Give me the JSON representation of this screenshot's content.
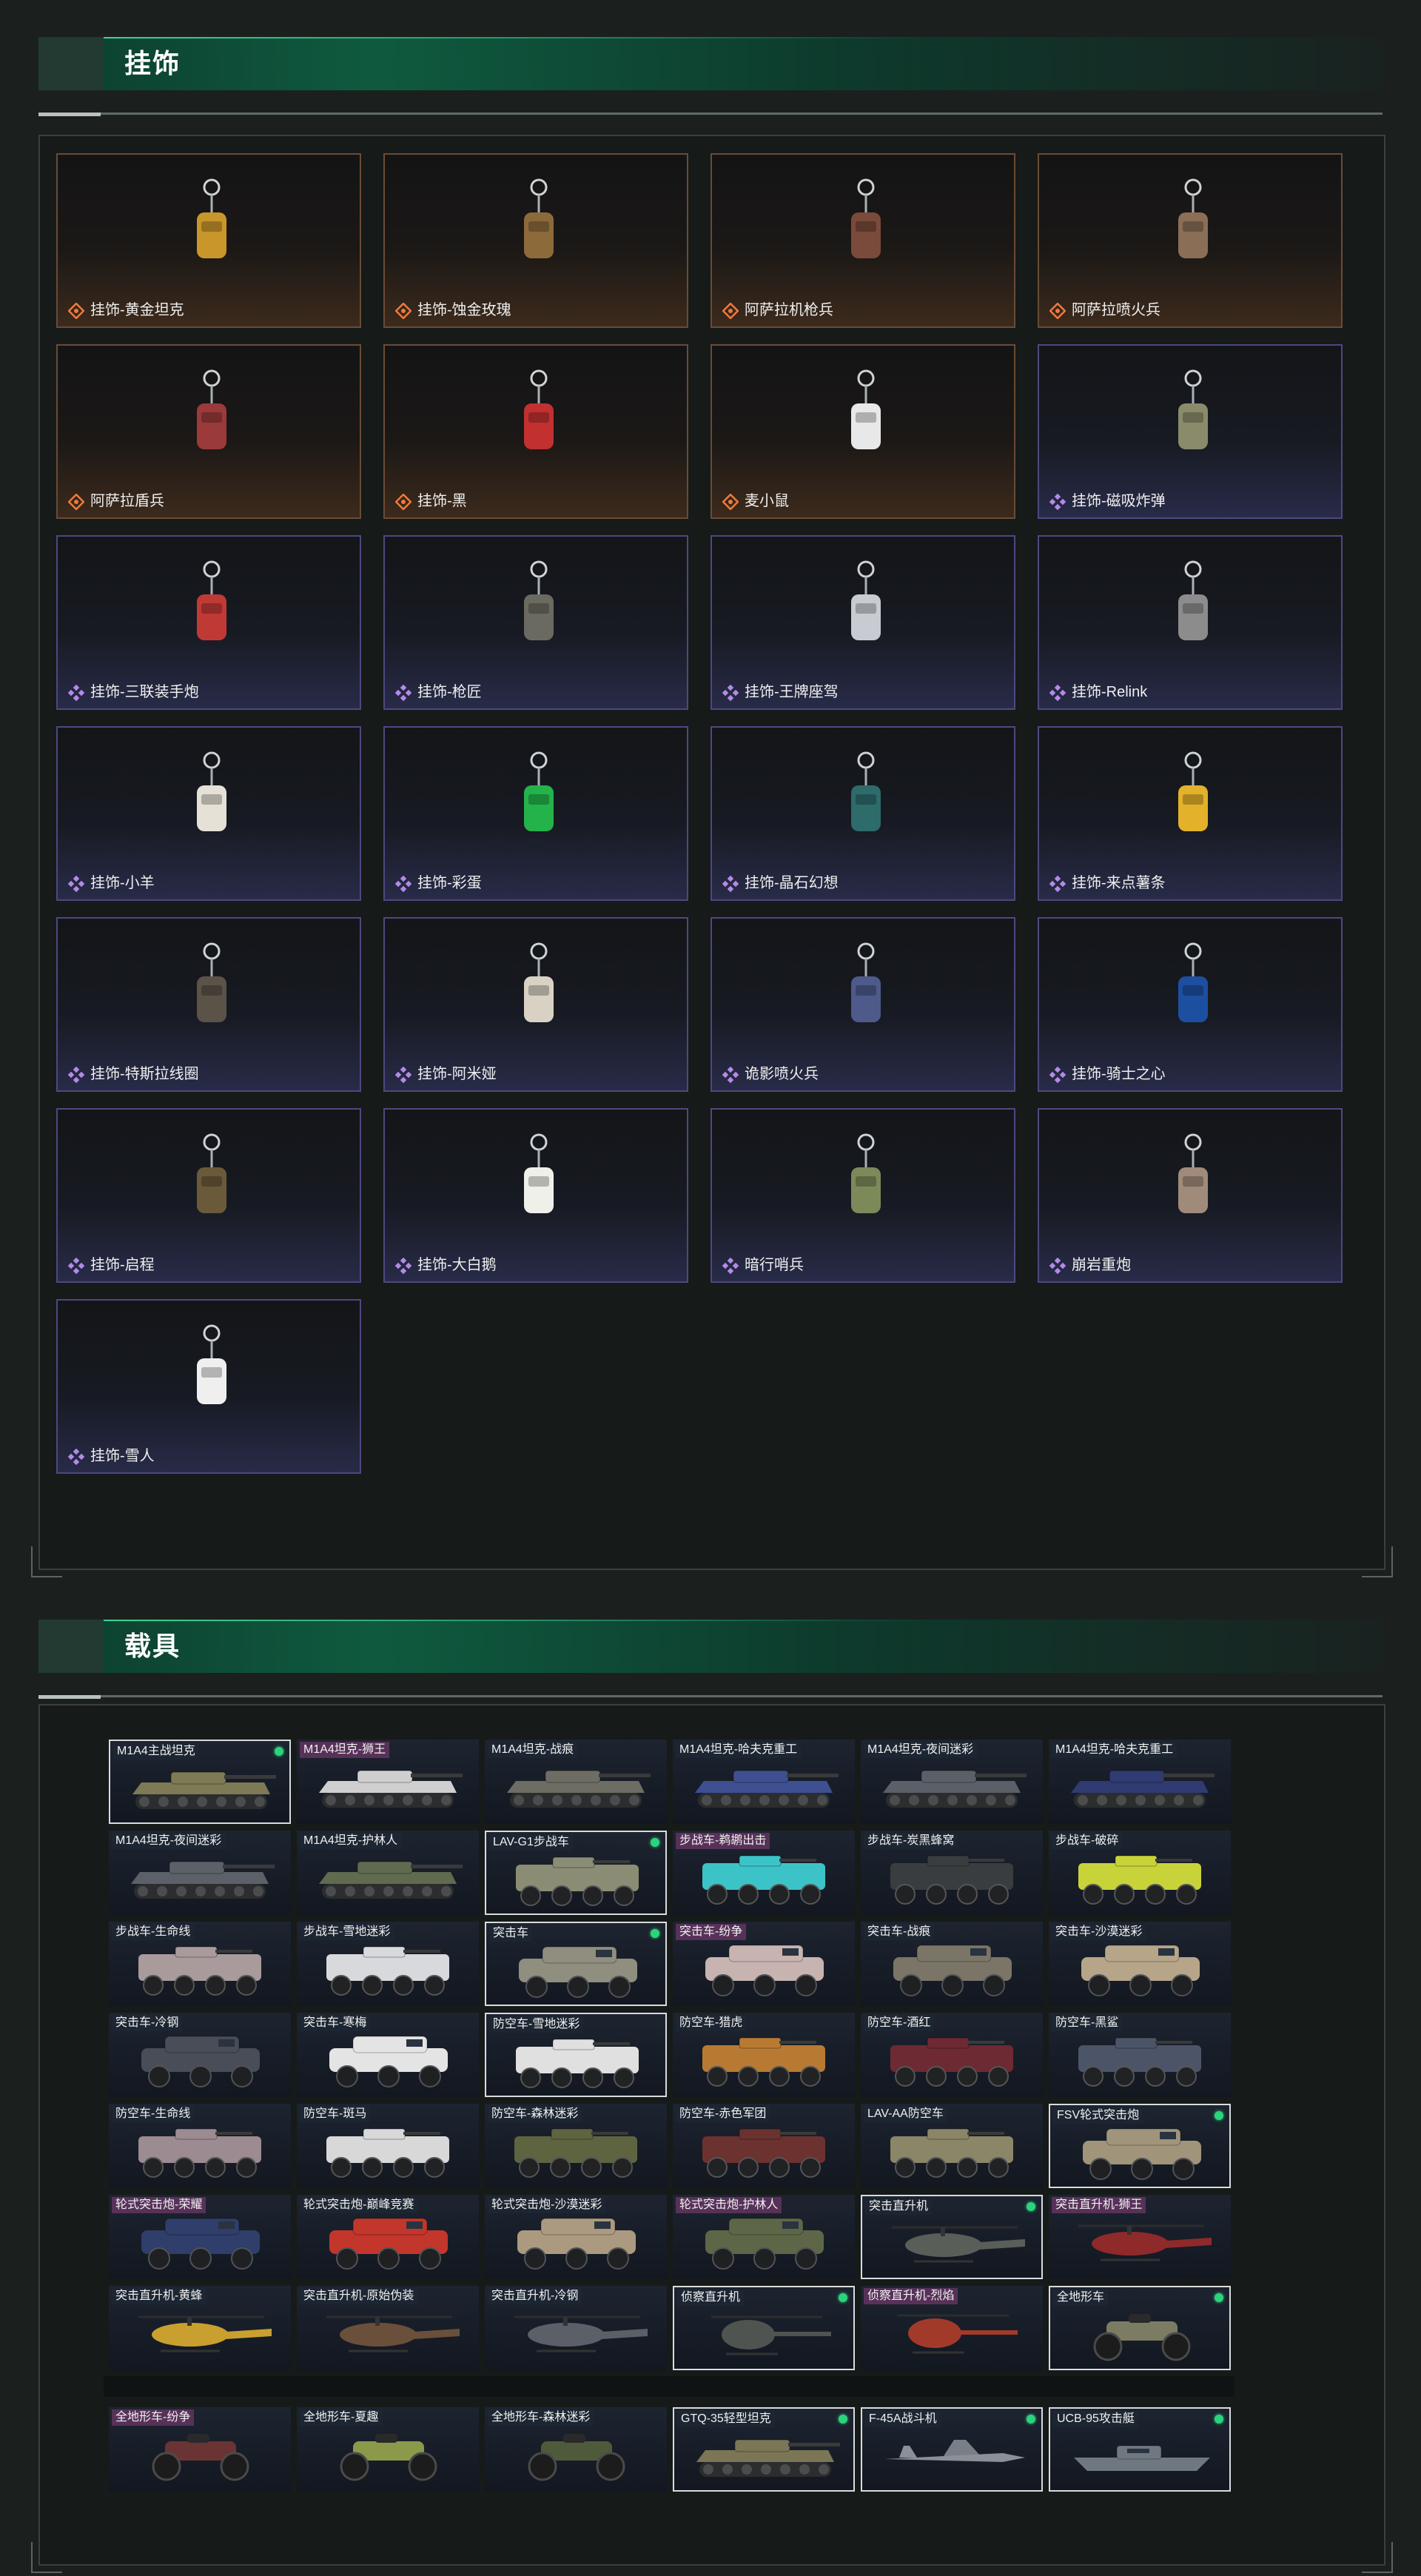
{
  "pendants_section": {
    "title": "挂饰",
    "items": [
      {
        "label": "挂饰-黄金坦克",
        "rarity": "legendary",
        "icon": "golden-tank-pendant-icon"
      },
      {
        "label": "挂饰-蚀金玫瑰",
        "rarity": "legendary",
        "icon": "rose-emblem-pendant-icon"
      },
      {
        "label": "阿萨拉机枪兵",
        "rarity": "legendary",
        "icon": "machine-gunner-figure-icon"
      },
      {
        "label": "阿萨拉喷火兵",
        "rarity": "legendary",
        "icon": "flamethrower-figure-icon"
      },
      {
        "label": "阿萨拉盾兵",
        "rarity": "legendary",
        "icon": "shield-soldier-figure-icon"
      },
      {
        "label": "挂饰-黑",
        "rarity": "legendary",
        "icon": "black-blade-pendant-icon"
      },
      {
        "label": "麦小鼠",
        "rarity": "legendary",
        "icon": "mouse-figure-icon"
      },
      {
        "label": "挂饰-磁吸炸弹",
        "rarity": "epic",
        "icon": "magnetic-bomb-pendant-icon"
      },
      {
        "label": "挂饰-三联装手炮",
        "rarity": "epic",
        "icon": "triple-hand-cannon-pendant-icon"
      },
      {
        "label": "挂饰-枪匠",
        "rarity": "epic",
        "icon": "gunsmith-box-pendant-icon"
      },
      {
        "label": "挂饰-王牌座驾",
        "rarity": "epic",
        "icon": "jet-plane-pendant-icon"
      },
      {
        "label": "挂饰-Relink",
        "rarity": "epic",
        "icon": "relink-emblem-pendant-icon"
      },
      {
        "label": "挂饰-小羊",
        "rarity": "epic",
        "icon": "lamb-pendant-icon"
      },
      {
        "label": "挂饰-彩蛋",
        "rarity": "epic",
        "icon": "green-egg-pendant-icon"
      },
      {
        "label": "挂饰-晶石幻想",
        "rarity": "epic",
        "icon": "crystal-cube-pendant-icon"
      },
      {
        "label": "挂饰-来点薯条",
        "rarity": "epic",
        "icon": "fries-pendant-icon"
      },
      {
        "label": "挂饰-特斯拉线圈",
        "rarity": "epic",
        "icon": "tesla-coil-pendant-icon"
      },
      {
        "label": "挂饰-阿米娅",
        "rarity": "epic",
        "icon": "bunny-pendant-icon"
      },
      {
        "label": "诡影喷火兵",
        "rarity": "epic",
        "icon": "shadow-flamethrower-figure-icon"
      },
      {
        "label": "挂饰-骑士之心",
        "rarity": "epic",
        "icon": "knight-heart-pendant-icon"
      },
      {
        "label": "挂饰-启程",
        "rarity": "epic",
        "icon": "departure-emblem-pendant-icon"
      },
      {
        "label": "挂饰-大白鹅",
        "rarity": "epic",
        "icon": "white-goose-pendant-icon"
      },
      {
        "label": "暗行哨兵",
        "rarity": "epic",
        "icon": "dark-sentinel-figure-icon"
      },
      {
        "label": "崩岩重炮",
        "rarity": "epic",
        "icon": "rock-cannon-figure-icon"
      },
      {
        "label": "挂饰-雪人",
        "rarity": "epic",
        "icon": "snowman-pendant-icon"
      }
    ]
  },
  "vehicles_section": {
    "title": "载具",
    "rows": [
      [
        {
          "label": "M1A4主战坦克",
          "sel": true,
          "dot": true,
          "tag": "plain",
          "kind": "tank",
          "color": "#7d7a55"
        },
        {
          "label": "M1A4坦克-狮王",
          "sel": false,
          "dot": false,
          "tag": "pink",
          "kind": "tank",
          "color": "#cfcfcf"
        },
        {
          "label": "M1A4坦克-战痕",
          "sel": false,
          "dot": false,
          "tag": "plain",
          "kind": "tank",
          "color": "#6d6d63"
        },
        {
          "label": "M1A4坦克-哈夫克重工",
          "sel": false,
          "dot": false,
          "tag": "plain",
          "kind": "tank",
          "color": "#3e4f92"
        },
        {
          "label": "M1A4坦克-夜间迷彩",
          "sel": false,
          "dot": false,
          "tag": "plain",
          "kind": "tank",
          "color": "#5b6068"
        },
        {
          "label": "M1A4坦克-哈夫克重工",
          "sel": false,
          "dot": false,
          "tag": "plain",
          "kind": "tank",
          "color": "#2f3b72"
        }
      ],
      [
        {
          "label": "M1A4坦克-夜间迷彩",
          "sel": false,
          "dot": false,
          "tag": "plain",
          "kind": "tank",
          "color": "#5c6169"
        },
        {
          "label": "M1A4坦克-护林人",
          "sel": false,
          "dot": false,
          "tag": "plain",
          "kind": "tank",
          "color": "#5f6a4f"
        },
        {
          "label": "LAV-G1步战车",
          "sel": true,
          "dot": true,
          "tag": "plain",
          "kind": "ifv",
          "color": "#8a8c74"
        },
        {
          "label": "步战车-鹈鹕出击",
          "sel": false,
          "dot": false,
          "tag": "pink",
          "kind": "ifv",
          "color": "#3cc3c7"
        },
        {
          "label": "步战车-炭黑蜂窝",
          "sel": false,
          "dot": false,
          "tag": "plain",
          "kind": "ifv",
          "color": "#3a3d40"
        },
        {
          "label": "步战车-破碎",
          "sel": false,
          "dot": false,
          "tag": "plain",
          "kind": "ifv",
          "color": "#c8d33a"
        }
      ],
      [
        {
          "label": "步战车-生命线",
          "sel": false,
          "dot": false,
          "tag": "plain",
          "kind": "ifv",
          "color": "#a99a9c"
        },
        {
          "label": "步战车-雪地迷彩",
          "sel": false,
          "dot": false,
          "tag": "plain",
          "kind": "ifv",
          "color": "#d7d9dc"
        },
        {
          "label": "突击车",
          "sel": true,
          "dot": true,
          "tag": "plain",
          "kind": "mrap",
          "color": "#8f8e7f"
        },
        {
          "label": "突击车-纷争",
          "sel": false,
          "dot": false,
          "tag": "pink",
          "kind": "mrap",
          "color": "#c7b4b0"
        },
        {
          "label": "突击车-战痕",
          "sel": false,
          "dot": false,
          "tag": "plain",
          "kind": "mrap",
          "color": "#7b7568"
        },
        {
          "label": "突击车-沙漠迷彩",
          "sel": false,
          "dot": false,
          "tag": "plain",
          "kind": "mrap",
          "color": "#b6a589"
        }
      ],
      [
        {
          "label": "突击车-冷钢",
          "sel": false,
          "dot": false,
          "tag": "plain",
          "kind": "mrap",
          "color": "#484d57"
        },
        {
          "label": "突击车-寒梅",
          "sel": false,
          "dot": false,
          "tag": "plain",
          "kind": "mrap",
          "color": "#e4e4e4"
        },
        {
          "label": "防空车-雪地迷彩",
          "sel": true,
          "dot": false,
          "tag": "plain",
          "kind": "ifv",
          "color": "#e0e0e0"
        },
        {
          "label": "防空车-猎虎",
          "sel": false,
          "dot": false,
          "tag": "plain",
          "kind": "ifv",
          "color": "#b87a33"
        },
        {
          "label": "防空车-酒红",
          "sel": false,
          "dot": false,
          "tag": "plain",
          "kind": "ifv",
          "color": "#6d2a33"
        },
        {
          "label": "防空车-黑鲨",
          "sel": false,
          "dot": false,
          "tag": "plain",
          "kind": "ifv",
          "color": "#4c5568"
        }
      ],
      [
        {
          "label": "防空车-生命线",
          "sel": false,
          "dot": false,
          "tag": "plain",
          "kind": "ifv",
          "color": "#9c8b90"
        },
        {
          "label": "防空车-斑马",
          "sel": false,
          "dot": false,
          "tag": "plain",
          "kind": "ifv",
          "color": "#d8d8d8"
        },
        {
          "label": "防空车-森林迷彩",
          "sel": false,
          "dot": false,
          "tag": "plain",
          "kind": "ifv",
          "color": "#5e6440"
        },
        {
          "label": "防空车-赤色军团",
          "sel": false,
          "dot": false,
          "tag": "plain",
          "kind": "ifv",
          "color": "#6b3230"
        },
        {
          "label": "LAV-AA防空车",
          "sel": false,
          "dot": false,
          "tag": "plain",
          "kind": "ifv",
          "color": "#8b8667"
        },
        {
          "label": "FSV轮式突击炮",
          "sel": true,
          "dot": true,
          "tag": "plain",
          "kind": "mrap",
          "color": "#a0957b"
        }
      ],
      [
        {
          "label": "轮式突击炮-荣耀",
          "sel": false,
          "dot": false,
          "tag": "pink",
          "kind": "mrap",
          "color": "#2f3e6a"
        },
        {
          "label": "轮式突击炮-巅峰竞赛",
          "sel": false,
          "dot": false,
          "tag": "plain",
          "kind": "mrap",
          "color": "#c2362c"
        },
        {
          "label": "轮式突击炮-沙漠迷彩",
          "sel": false,
          "dot": false,
          "tag": "plain",
          "kind": "mrap",
          "color": "#ab9a80"
        },
        {
          "label": "轮式突击炮-护林人",
          "sel": false,
          "dot": false,
          "tag": "pink",
          "kind": "mrap",
          "color": "#5d6748"
        },
        {
          "label": "突击直升机",
          "sel": true,
          "dot": true,
          "tag": "plain",
          "kind": "heli",
          "color": "#595e58"
        },
        {
          "label": "突击直升机-狮王",
          "sel": false,
          "dot": false,
          "tag": "pink",
          "kind": "heli",
          "color": "#8e2a2a"
        }
      ],
      [
        {
          "label": "突击直升机-黄蜂",
          "sel": false,
          "dot": false,
          "tag": "plain",
          "kind": "heli",
          "color": "#c9a02f"
        },
        {
          "label": "突击直升机-原始伪装",
          "sel": false,
          "dot": false,
          "tag": "plain",
          "kind": "heli",
          "color": "#6a4f3a"
        },
        {
          "label": "突击直升机-冷钢",
          "sel": false,
          "dot": false,
          "tag": "plain",
          "kind": "heli",
          "color": "#5a5f68"
        },
        {
          "label": "侦察直升机",
          "sel": true,
          "dot": true,
          "tag": "plain",
          "kind": "scout",
          "color": "#4f5450"
        },
        {
          "label": "侦察直升机-烈焰",
          "sel": false,
          "dot": false,
          "tag": "pink",
          "kind": "scout",
          "color": "#a23a2a"
        },
        {
          "label": "全地形车",
          "sel": true,
          "dot": true,
          "tag": "plain",
          "kind": "atv",
          "color": "#7c7c62"
        }
      ],
      [
        {
          "label": "全地形车-纷争",
          "sel": false,
          "dot": false,
          "tag": "pink",
          "kind": "atv",
          "color": "#6b3434"
        },
        {
          "label": "全地形车-夏趣",
          "sel": false,
          "dot": false,
          "tag": "plain",
          "kind": "atv",
          "color": "#8a9a4a"
        },
        {
          "label": "全地形车-森林迷彩",
          "sel": false,
          "dot": false,
          "tag": "plain",
          "kind": "atv",
          "color": "#4f5a3a"
        },
        {
          "label": "GTQ-35轻型坦克",
          "sel": true,
          "dot": true,
          "tag": "plain",
          "kind": "tank",
          "color": "#7b7656"
        },
        {
          "label": "F-45A战斗机",
          "sel": true,
          "dot": true,
          "tag": "plain",
          "kind": "jet",
          "color": "#8a9097"
        },
        {
          "label": "UCB-95攻击艇",
          "sel": true,
          "dot": true,
          "tag": "plain",
          "kind": "boat",
          "color": "#6f7880"
        }
      ]
    ]
  }
}
